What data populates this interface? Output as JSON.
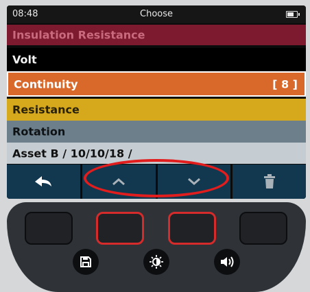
{
  "status": {
    "time": "08:48",
    "title": "Choose"
  },
  "menu": {
    "items": [
      {
        "label": "Insulation Resistance"
      },
      {
        "label": "Volt"
      },
      {
        "label": "Continuity",
        "count": "[ 8 ]",
        "selected": true
      },
      {
        "label": "Resistance"
      },
      {
        "label": "Rotation"
      }
    ],
    "path": "Asset B /  10/10/18  /"
  },
  "softkeys": [
    "back-arrow-icon",
    "chevron-up-icon",
    "chevron-down-icon",
    "trash-icon"
  ],
  "hardware": {
    "round_buttons": [
      "save-icon",
      "brightness-icon",
      "volume-icon"
    ]
  },
  "colors": {
    "highlight": "#e11d1d",
    "continuity": "#d8692b",
    "insulation": "#7d1a30",
    "resistance": "#d6a81c",
    "rotation": "#6d7f8a"
  }
}
